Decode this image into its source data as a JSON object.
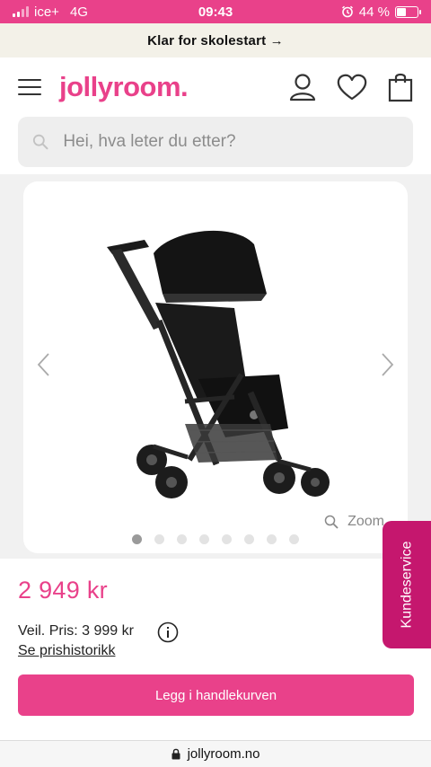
{
  "status_bar": {
    "carrier": "ice+",
    "network": "4G",
    "time": "09:43",
    "battery": "44 %"
  },
  "promo": {
    "text": "Klar for skolestart →"
  },
  "header": {
    "logo": "jollyroom."
  },
  "search": {
    "placeholder": "Hei, hva leter du etter?"
  },
  "gallery": {
    "zoom_label": "Zoom",
    "image_count": 8,
    "active_index": 0
  },
  "product": {
    "price": "2 949 kr",
    "rrp": "Veil. Pris: 3 999 kr",
    "history_link": "Se prishistorikk",
    "cart_button": "Legg i handlekurven"
  },
  "side_tab": {
    "label": "Kundeservice"
  },
  "browser": {
    "url": "jollyroom.no"
  },
  "colors": {
    "brand_pink": "#e9418a",
    "tab_magenta": "#c5176e",
    "promo_bg": "#f3f1e8"
  }
}
